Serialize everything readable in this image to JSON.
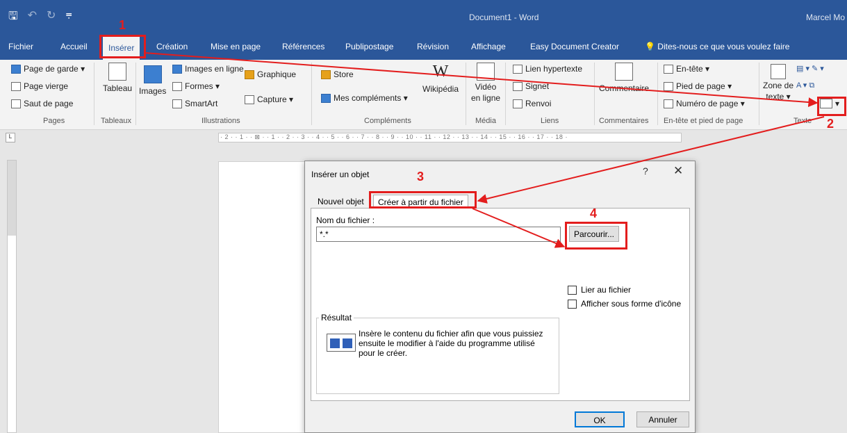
{
  "window": {
    "title": "Document1 - Word",
    "user": "Marcel Mo"
  },
  "qat": {
    "save_icon": "save-icon",
    "undo_icon": "undo-icon",
    "redo_icon": "redo-icon",
    "customize_icon": "customize-icon"
  },
  "tabs": [
    {
      "label": "Fichier"
    },
    {
      "label": "Accueil"
    },
    {
      "label": "Insérer"
    },
    {
      "label": "Création"
    },
    {
      "label": "Mise en page"
    },
    {
      "label": "Références"
    },
    {
      "label": "Publipostage"
    },
    {
      "label": "Révision"
    },
    {
      "label": "Affichage"
    },
    {
      "label": "Easy Document Creator"
    },
    {
      "label": "Dites-nous ce que vous voulez faire"
    }
  ],
  "ribbon": {
    "pages": {
      "label": "Pages",
      "cover": "Page de garde ▾",
      "blank": "Page vierge",
      "break": "Saut de page"
    },
    "tables": {
      "label": "Tableaux",
      "table": "Tableau"
    },
    "illustrations": {
      "label": "Illustrations",
      "images": "Images",
      "online_images": "Images en ligne",
      "shapes": "Formes ▾",
      "smartart": "SmartArt",
      "chart": "Graphique",
      "capture": "Capture ▾"
    },
    "addins": {
      "label": "Compléments",
      "store": "Store",
      "my_addins": "Mes compléments ▾",
      "wikipedia": "Wikipédia"
    },
    "media": {
      "label": "Média",
      "video_l1": "Vidéo",
      "video_l2": "en ligne"
    },
    "links": {
      "label": "Liens",
      "hyperlink": "Lien hypertexte",
      "bookmark": "Signet",
      "crossref": "Renvoi"
    },
    "comments": {
      "label": "Commentaires",
      "comment": "Commentaire"
    },
    "headerfooter": {
      "label": "En-tête et pied de page",
      "header": "En-tête ▾",
      "footer": "Pied de page ▾",
      "pagenum": "Numéro de page ▾"
    },
    "text": {
      "label": "Texte",
      "textbox_l1": "Zone de",
      "textbox_l2": "texte ▾"
    }
  },
  "ruler": {
    "scale": "· 2 · · 1 · · ⊠ · · 1 · · 2 · · 3 · · 4 · · 5 · · 6 · · 7 · · 8 · · 9 · · 10 · · 11 · · 12 · · 13 · · 14 · · 15 · · 16 · · 17 · · 18 ·",
    "corner": "L"
  },
  "dialog": {
    "title": "Insérer un objet",
    "help": "?",
    "close": "✕",
    "tabs": [
      {
        "label": "Nouvel objet"
      },
      {
        "label": "Créer à partir du fichier"
      }
    ],
    "filename_label": "Nom du fichier :",
    "filename_value": "*.*",
    "browse": "Parcourir...",
    "link_to_file": "Lier au fichier",
    "display_as_icon": "Afficher sous forme d'icône",
    "result_label": "Résultat",
    "result_text": "Insère le contenu du fichier afin que vous puissiez ensuite le modifier à l'aide du programme utilisé pour le créer.",
    "ok": "OK",
    "cancel": "Annuler"
  },
  "annotations": {
    "color": "#e31d1d",
    "n1": "1",
    "n2": "2",
    "n3": "3",
    "n4": "4"
  },
  "colors": {
    "word_blue": "#2b579a",
    "ribbon_bg": "#f3f3f3",
    "dialog_bg": "#f0f0f0",
    "focus": "#0078d7"
  }
}
